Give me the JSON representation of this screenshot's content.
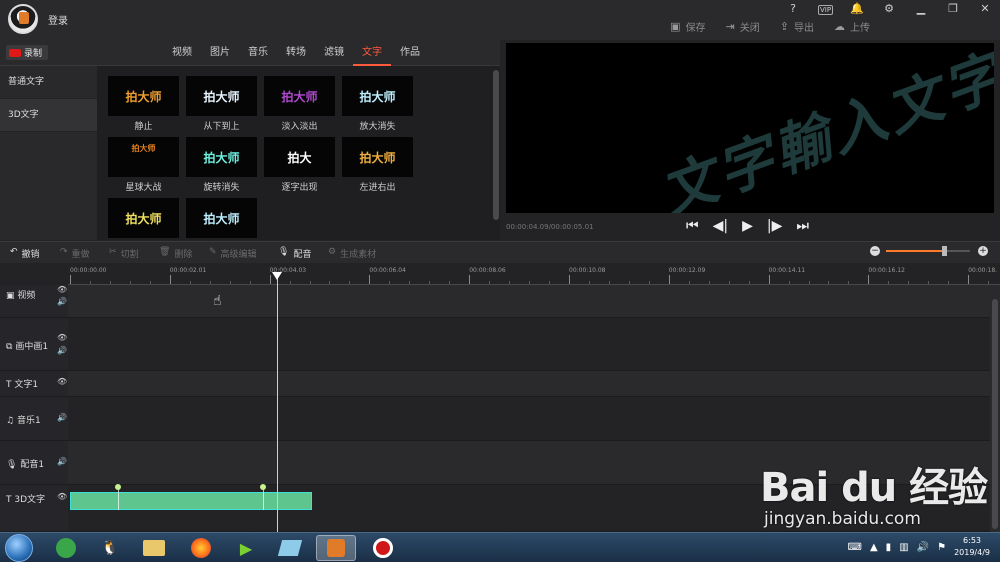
{
  "titlebar": {
    "login_label": "登录",
    "help": "?",
    "vip": "VIP",
    "actions": [
      {
        "icon": "save-icon",
        "label": "保存"
      },
      {
        "icon": "close-icon",
        "label": "关闭"
      },
      {
        "icon": "export-icon",
        "label": "导出"
      },
      {
        "icon": "upload-icon",
        "label": "上传"
      }
    ]
  },
  "record_label": "录制",
  "tabs": [
    {
      "label": "视频"
    },
    {
      "label": "图片"
    },
    {
      "label": "音乐"
    },
    {
      "label": "转场"
    },
    {
      "label": "滤镜"
    },
    {
      "label": "文字"
    },
    {
      "label": "作品"
    }
  ],
  "active_tab": "文字",
  "categories": [
    {
      "label": "普通文字"
    },
    {
      "label": "3D文字"
    }
  ],
  "thumbnails": [
    {
      "preview": "拍大师",
      "label": "静止",
      "color": "#f0a030"
    },
    {
      "preview": "拍大师",
      "label": "从下到上",
      "color": "#e8f4ff"
    },
    {
      "preview": "拍大师",
      "label": "淡入淡出",
      "color": "#b04ad0"
    },
    {
      "preview": "拍大师",
      "label": "放大消失",
      "color": "#bfefff"
    },
    {
      "preview": "拍大师",
      "label": "星球大战",
      "color": "#e08020"
    },
    {
      "preview": "拍大师",
      "label": "旋转消失",
      "color": "#6ef0e0"
    },
    {
      "preview": "拍大",
      "label": "逐字出现",
      "color": "#ffffff"
    },
    {
      "preview": "拍大师",
      "label": "左进右出",
      "color": "#f0b040"
    },
    {
      "preview": "拍大师",
      "label": "",
      "color": "#f0e060"
    },
    {
      "preview": "拍大师",
      "label": "",
      "color": "#bfefff"
    }
  ],
  "preview": {
    "timecode": "00:00:04.09/00:00:05.01"
  },
  "edit_toolbar": {
    "undo": "撤销",
    "redo": "重做",
    "cut": "切割",
    "delete": "删除",
    "advanced": "高级编辑",
    "dub": "配音",
    "generate": "生成素材"
  },
  "ruler_labels": [
    "00:00:00.00",
    "00:00:02.01",
    "00:00:04.03",
    "00:00:06.04",
    "00:00:08.06",
    "00:00:10.08",
    "00:00:12.09",
    "00:00:14.11",
    "00:00:16.12",
    "00:00:18."
  ],
  "tracks": [
    {
      "label": "视频",
      "icon": "video-icon"
    },
    {
      "label": "画中画1",
      "icon": "pip-icon"
    },
    {
      "label": "文字1",
      "icon": "text-icon"
    },
    {
      "label": "音乐1",
      "icon": "music-icon"
    },
    {
      "label": "配音1",
      "icon": "mic-icon"
    },
    {
      "label": "3D文字",
      "icon": "text-icon"
    }
  ],
  "zoom_level": 0.69,
  "taskbar": {
    "time": "6:53",
    "date": "2019/4/9"
  },
  "watermark": {
    "logo": "Bai du 经验",
    "url": "jingyan.baidu.com"
  }
}
